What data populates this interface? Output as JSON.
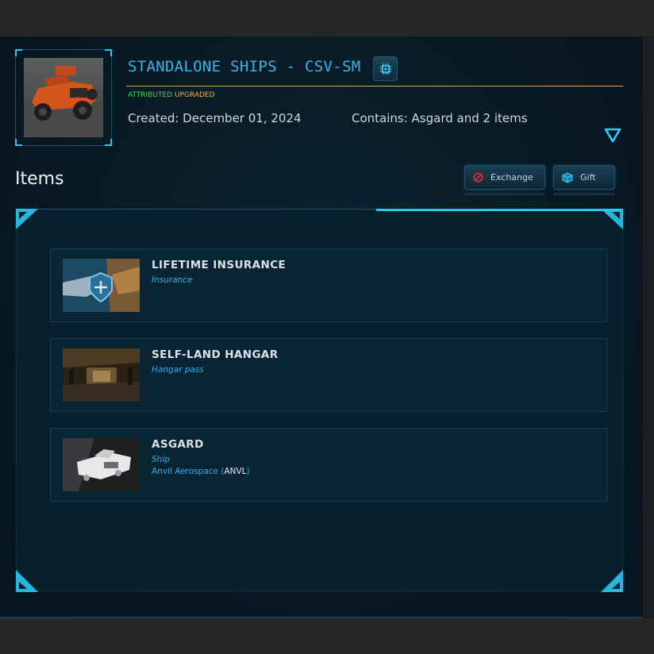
{
  "pledge": {
    "title": "STANDALONE SHIPS - CSV-SM",
    "tags": {
      "attributed": "ATTRIBUTED",
      "upgraded": "UPGRADED"
    },
    "created": "Created: December 01, 2024",
    "contains": "Contains: Asgard and 2 items",
    "chip_icon": "chip-icon",
    "collapse_icon": "triangle-down-icon"
  },
  "items_section": {
    "heading": "Items",
    "actions": [
      {
        "label": "Exchange",
        "icon": "no-entry-icon",
        "icon_color": "#e8242f"
      },
      {
        "label": "Gift",
        "icon": "gift-box-icon",
        "icon_color": "#36c6f0"
      }
    ],
    "items": [
      {
        "name": "LIFETIME INSURANCE",
        "type": "Insurance",
        "manufacturer": "",
        "code": ""
      },
      {
        "name": "SELF-LAND HANGAR",
        "type": "Hangar pass",
        "manufacturer": "",
        "code": ""
      },
      {
        "name": "ASGARD",
        "type": "Ship",
        "manufacturer": "Anvil Aerospace (",
        "code": "ANVL",
        "close": ")"
      }
    ]
  },
  "colors": {
    "accent": "#2bc5ef",
    "title": "#39b4e8",
    "rule": "#d7a64a",
    "attributed": "#35e04b",
    "upgraded": "#f2b23a"
  }
}
